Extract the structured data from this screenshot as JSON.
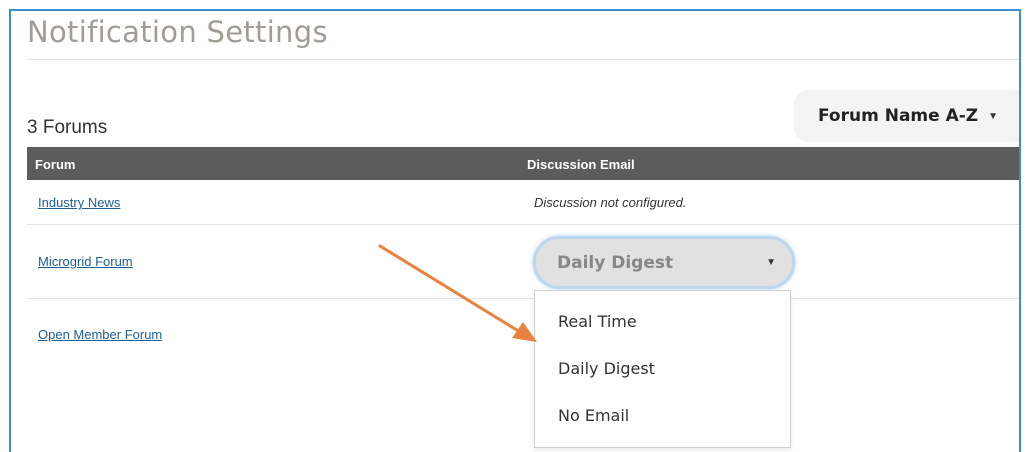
{
  "page": {
    "title": "Notification Settings",
    "forum_count": "3 Forums",
    "sort": {
      "label": "Forum Name A-Z",
      "icon": "caret-down-icon"
    }
  },
  "table": {
    "columns": [
      "Forum",
      "Discussion Email"
    ],
    "rows": [
      {
        "forum": "Industry News",
        "email_status": "Discussion not configured."
      },
      {
        "forum": "Microgrid Forum",
        "email_selected": "Daily Digest"
      },
      {
        "forum": "Open Member Forum"
      }
    ]
  },
  "dropdown": {
    "options": [
      "Real Time",
      "Daily Digest",
      "No Email"
    ]
  },
  "annotation": {
    "arrow_color": "#e8823e"
  },
  "colors": {
    "frame_border": "#3b8fce",
    "header_bg": "#5c5c5c",
    "link": "#1f5f96"
  }
}
